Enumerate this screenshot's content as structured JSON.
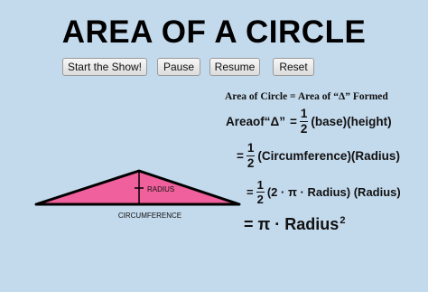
{
  "title": "AREA OF A CIRCLE",
  "buttons": {
    "start": "Start the Show!",
    "pause": "Pause",
    "resume": "Resume",
    "reset": "Reset"
  },
  "heading": "Area of Circle = Area of “Δ” Formed",
  "equations": {
    "eq1_lhs": "Areaof“Δ”",
    "equals": "=",
    "half_num": "1",
    "half_den": "2",
    "eq1_rhs": "(base)(height)",
    "eq2_rhs": "(Circumference)(Radius)",
    "eq3_rhs": "(2 · π · Radius) (Radius)",
    "eq4_rhs": "π · Radius",
    "eq4_exp": "2"
  },
  "diagram": {
    "radius_label": "RADIUS",
    "base_label": "CIRCUMFERENCE",
    "fill_color": "#f0609c",
    "stroke_color": "#000000"
  }
}
